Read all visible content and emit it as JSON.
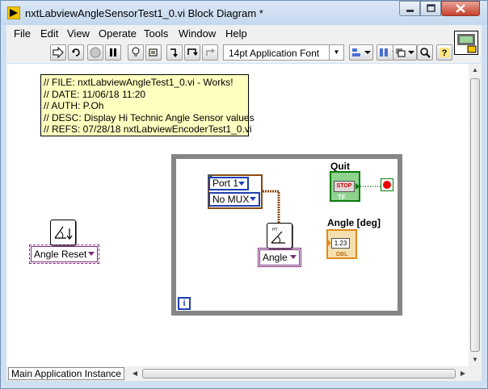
{
  "window": {
    "title": "nxtLabviewAngleSensorTest1_0.vi Block Diagram *"
  },
  "menu": [
    "File",
    "Edit",
    "View",
    "Operate",
    "Tools",
    "Window",
    "Help"
  ],
  "toolbar": {
    "font": "14pt Application Font"
  },
  "comment": [
    "// FILE: nxtLabviewAngleTest1_0.vi - Works!",
    "// DATE: 11/06/18 11:20",
    "// AUTH: P.Oh",
    "// DESC: Display Hi Technic Angle Sensor values",
    "// REFS: 07/28/18 nxtLabviewEncoderTest1_0.vi"
  ],
  "diagram": {
    "angle_reset": "Angle Reset",
    "port": "Port 1",
    "mux": "No MUX",
    "angle_mode": "Angle",
    "quit_label": "Quit",
    "stop_text": "STOP",
    "tf_text": "TF",
    "angle_deg_label": "Angle [deg]",
    "dbl_value": "1.23",
    "dbl_text": "DBL",
    "iteration": "i"
  },
  "status": {
    "context": "Main Application Instance"
  },
  "colors": {
    "comment_bg": "#ffffc0",
    "loop_border": "#868686",
    "boolean_wire": "#0a7a0a",
    "cluster_wire": "#8a4a10",
    "ring_border": "#7a2c7a"
  }
}
